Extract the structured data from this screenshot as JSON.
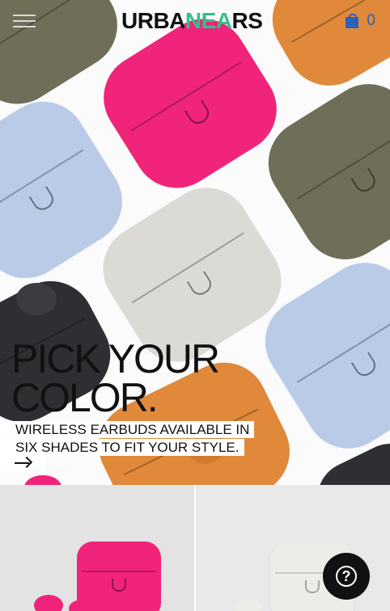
{
  "header": {
    "menu_icon": "hamburger-menu-icon",
    "brand_start": "URBA",
    "brand_mid": "NEA",
    "brand_end": "RS",
    "cart_icon": "shopping-bag-icon",
    "cart_count": "0"
  },
  "hero": {
    "title_line1": "PICK YOUR",
    "title_line2": "COLOR.",
    "subtitle_line1": "WIRELESS EARBUDS AVAILABLE IN",
    "subtitle_line2": "SIX SHADES TO FIT YOUR STYLE.",
    "arrow_icon": "arrow-right-icon"
  },
  "colors": {
    "brand_accent": "#33c08a",
    "cart_blue": "#2b62b8",
    "pink": "#f0247a",
    "olive": "#6f6e59",
    "light_blue": "#b9cbe6",
    "stone": "#dcdad4",
    "orange": "#e1893a",
    "charcoal": "#2d2f33"
  },
  "help": {
    "icon": "question-mark-icon",
    "glyph": "?"
  }
}
